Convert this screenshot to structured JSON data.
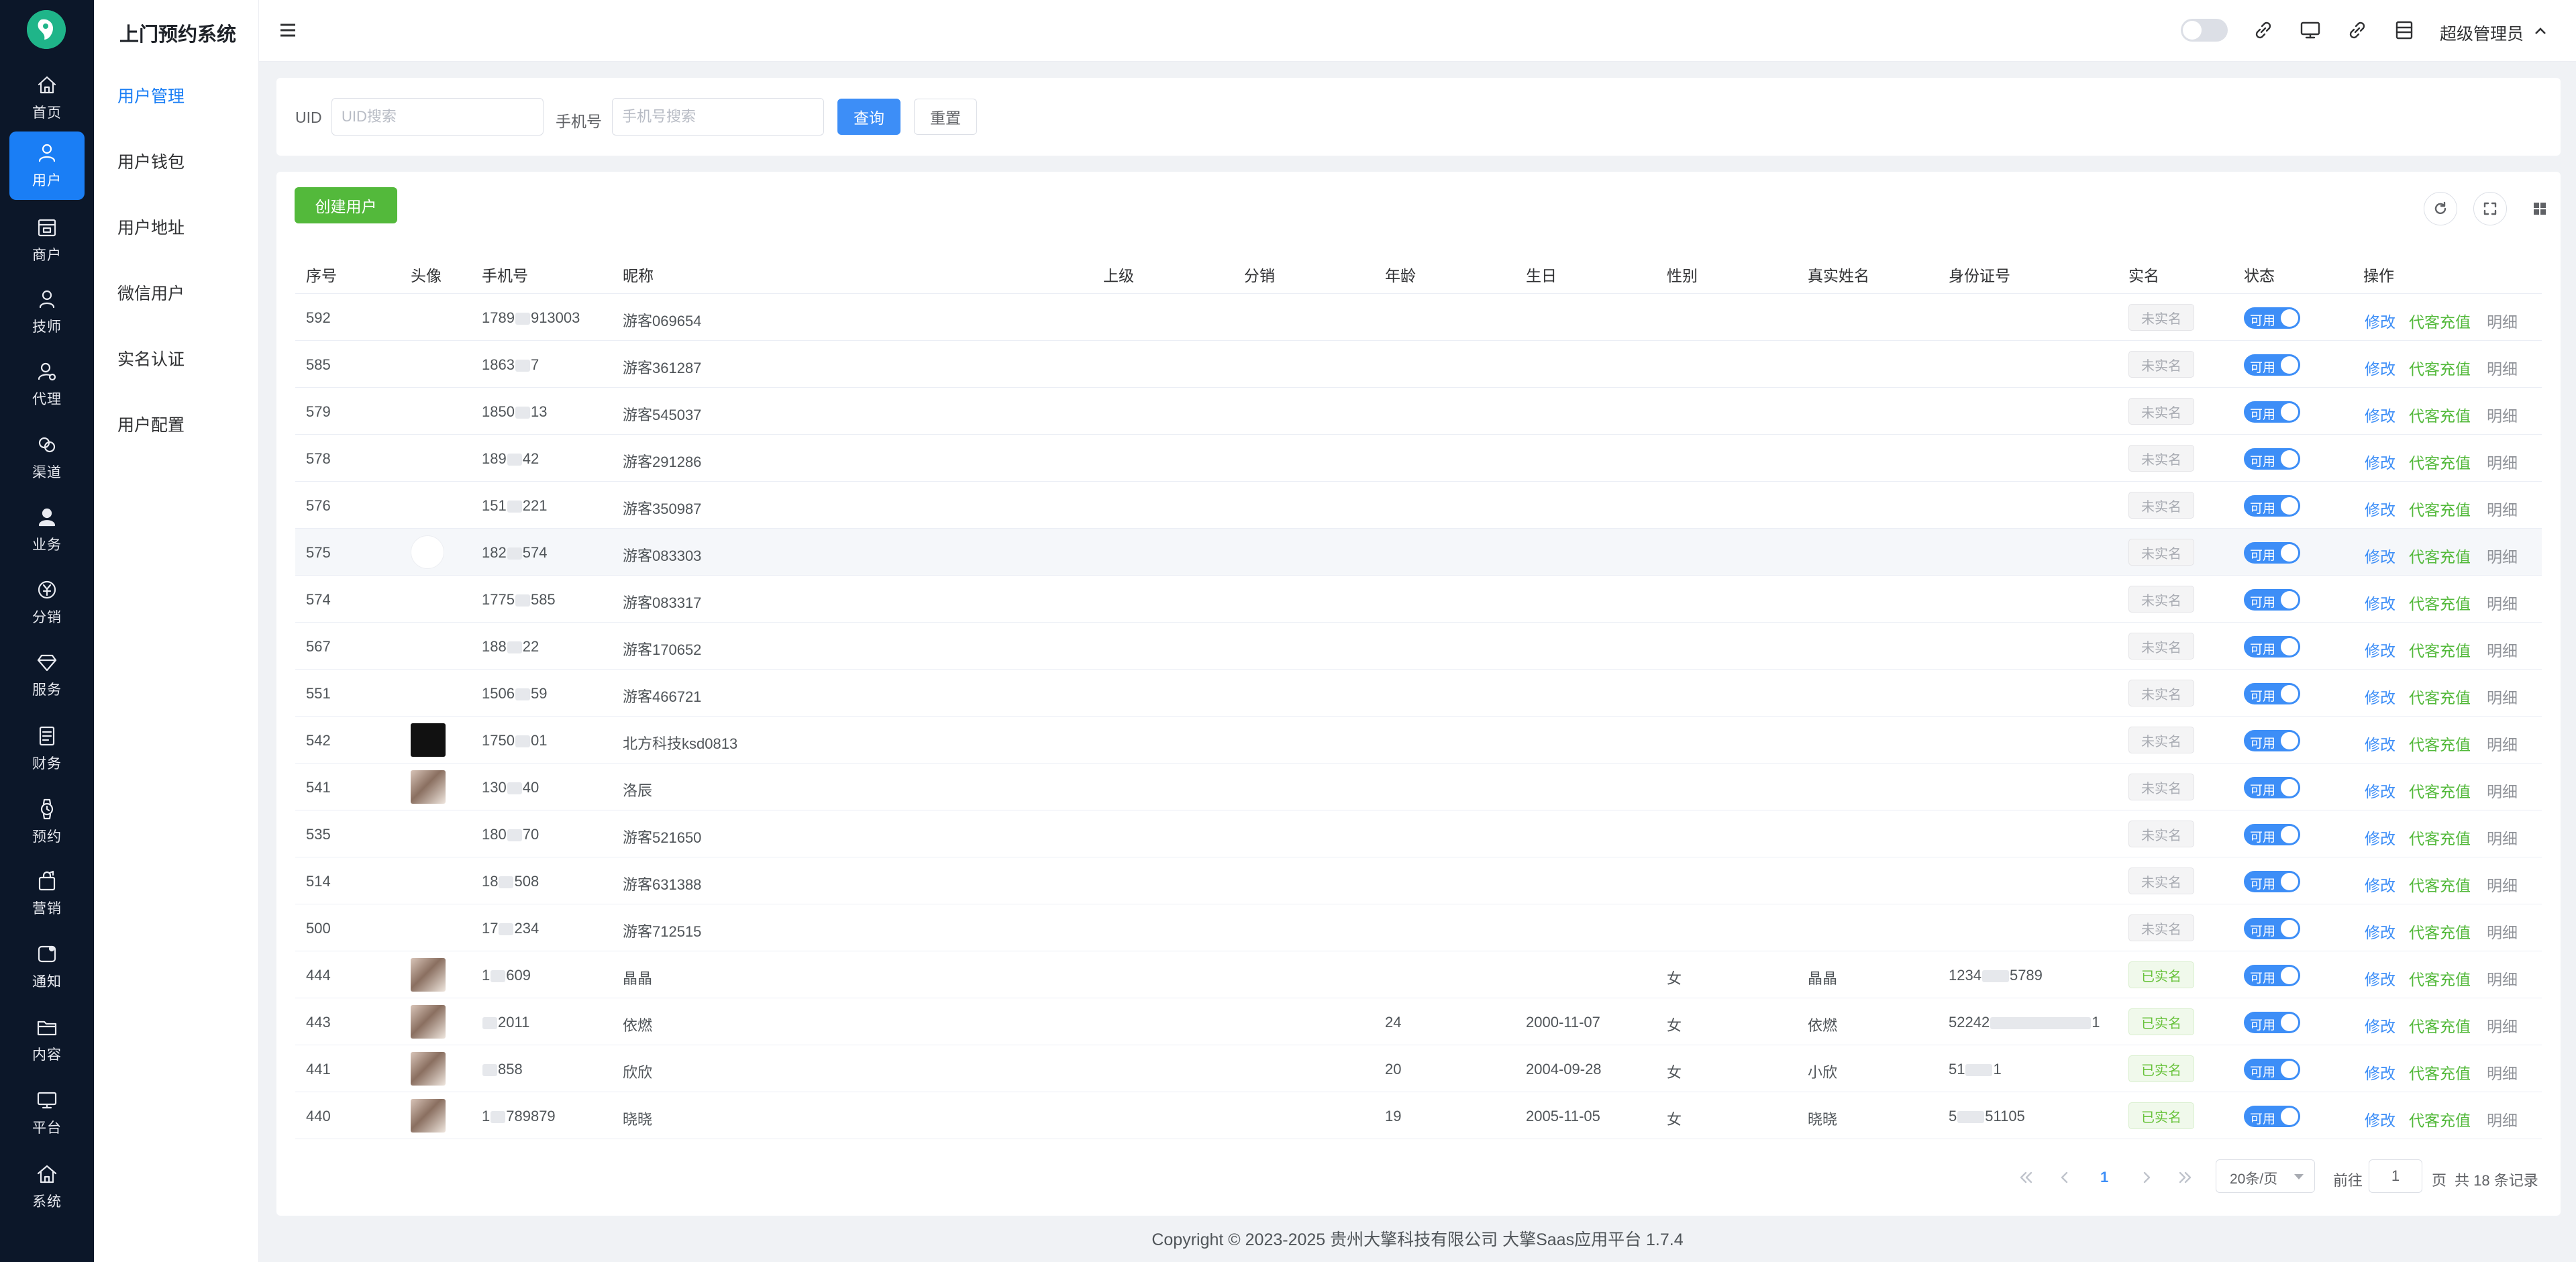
{
  "app": {
    "title": "上门预约系统"
  },
  "rail": [
    {
      "key": "home",
      "label": "首页",
      "icon": "home-icon"
    },
    {
      "key": "user",
      "label": "用户",
      "icon": "user-icon",
      "active": true
    },
    {
      "key": "merchant",
      "label": "商户",
      "icon": "shop-icon"
    },
    {
      "key": "tech",
      "label": "技师",
      "icon": "person-icon"
    },
    {
      "key": "agent",
      "label": "代理",
      "icon": "agent-icon"
    },
    {
      "key": "channel",
      "label": "渠道",
      "icon": "link-icon"
    },
    {
      "key": "business",
      "label": "业务",
      "icon": "person-solid-icon"
    },
    {
      "key": "distribution",
      "label": "分销",
      "icon": "yen-icon"
    },
    {
      "key": "service",
      "label": "服务",
      "icon": "diamond-icon"
    },
    {
      "key": "finance",
      "label": "财务",
      "icon": "document-icon"
    },
    {
      "key": "booking",
      "label": "预约",
      "icon": "watch-icon"
    },
    {
      "key": "marketing",
      "label": "营销",
      "icon": "bag-icon"
    },
    {
      "key": "notice",
      "label": "通知",
      "icon": "message-icon"
    },
    {
      "key": "content",
      "label": "内容",
      "icon": "folder-icon"
    },
    {
      "key": "platform",
      "label": "平台",
      "icon": "monitor-icon"
    },
    {
      "key": "system",
      "label": "系统",
      "icon": "house-icon"
    }
  ],
  "submenu": [
    {
      "label": "用户管理",
      "active": true
    },
    {
      "label": "用户钱包"
    },
    {
      "label": "用户地址"
    },
    {
      "label": "微信用户"
    },
    {
      "label": "实名认证"
    },
    {
      "label": "用户配置"
    }
  ],
  "topbar": {
    "user_name": "超级管理员"
  },
  "search": {
    "uid_label": "UID",
    "uid_placeholder": "UID搜索",
    "phone_label": "手机号",
    "phone_placeholder": "手机号搜索",
    "query_button": "查询",
    "reset_button": "重置"
  },
  "table": {
    "create_button": "创建用户",
    "columns": [
      "序号",
      "头像",
      "手机号",
      "昵称",
      "上级",
      "分销",
      "年龄",
      "生日",
      "性别",
      "真实姓名",
      "身份证号",
      "实名",
      "状态",
      "操作"
    ],
    "switch_label": "可用",
    "op_edit": "修改",
    "op_charge": "代客充值",
    "op_detail": "明细",
    "rows": [
      {
        "id": "592",
        "avatar": "",
        "phone_a": "1789",
        "phone_b": "913003",
        "nickname": "游客069654",
        "age": "",
        "birthday": "",
        "gender": "",
        "real_name": "",
        "idcard_a": "",
        "idcard_b": "",
        "verified": "未实名"
      },
      {
        "id": "585",
        "avatar": "",
        "phone_a": "1863",
        "phone_b": "7",
        "nickname": "游客361287",
        "age": "",
        "birthday": "",
        "gender": "",
        "real_name": "",
        "idcard_a": "",
        "idcard_b": "",
        "verified": "未实名"
      },
      {
        "id": "579",
        "avatar": "",
        "phone_a": "1850",
        "phone_b": "13",
        "nickname": "游客545037",
        "age": "",
        "birthday": "",
        "gender": "",
        "real_name": "",
        "idcard_a": "",
        "idcard_b": "",
        "verified": "未实名"
      },
      {
        "id": "578",
        "avatar": "",
        "phone_a": "189",
        "phone_b": "42",
        "nickname": "游客291286",
        "age": "",
        "birthday": "",
        "gender": "",
        "real_name": "",
        "idcard_a": "",
        "idcard_b": "",
        "verified": "未实名"
      },
      {
        "id": "576",
        "avatar": "",
        "phone_a": "151",
        "phone_b": "221",
        "nickname": "游客350987",
        "age": "",
        "birthday": "",
        "gender": "",
        "real_name": "",
        "idcard_a": "",
        "idcard_b": "",
        "verified": "未实名"
      },
      {
        "id": "575",
        "avatar": "blank",
        "phone_a": "182",
        "phone_b": "574",
        "nickname": "游客083303",
        "age": "",
        "birthday": "",
        "gender": "",
        "real_name": "",
        "idcard_a": "",
        "idcard_b": "",
        "verified": "未实名",
        "hover": true
      },
      {
        "id": "574",
        "avatar": "",
        "phone_a": "1775",
        "phone_b": "585",
        "nickname": "游客083317",
        "age": "",
        "birthday": "",
        "gender": "",
        "real_name": "",
        "idcard_a": "",
        "idcard_b": "",
        "verified": "未实名"
      },
      {
        "id": "567",
        "avatar": "",
        "phone_a": "188",
        "phone_b": "22",
        "nickname": "游客170652",
        "age": "",
        "birthday": "",
        "gender": "",
        "real_name": "",
        "idcard_a": "",
        "idcard_b": "",
        "verified": "未实名"
      },
      {
        "id": "551",
        "avatar": "",
        "phone_a": "1506",
        "phone_b": "59",
        "nickname": "游客466721",
        "age": "",
        "birthday": "",
        "gender": "",
        "real_name": "",
        "idcard_a": "",
        "idcard_b": "",
        "verified": "未实名"
      },
      {
        "id": "542",
        "avatar": "dark",
        "phone_a": "1750",
        "phone_b": "01",
        "nickname": "北方科技ksd0813",
        "age": "",
        "birthday": "",
        "gender": "",
        "real_name": "",
        "idcard_a": "",
        "idcard_b": "",
        "verified": "未实名"
      },
      {
        "id": "541",
        "avatar": "photo",
        "phone_a": "130",
        "phone_b": "40",
        "nickname": "洛辰",
        "age": "",
        "birthday": "",
        "gender": "",
        "real_name": "",
        "idcard_a": "",
        "idcard_b": "",
        "verified": "未实名"
      },
      {
        "id": "535",
        "avatar": "",
        "phone_a": "180",
        "phone_b": "70",
        "nickname": "游客521650",
        "age": "",
        "birthday": "",
        "gender": "",
        "real_name": "",
        "idcard_a": "",
        "idcard_b": "",
        "verified": "未实名"
      },
      {
        "id": "514",
        "avatar": "",
        "phone_a": "18",
        "phone_b": "508",
        "nickname": "游客631388",
        "age": "",
        "birthday": "",
        "gender": "",
        "real_name": "",
        "idcard_a": "",
        "idcard_b": "",
        "verified": "未实名"
      },
      {
        "id": "500",
        "avatar": "",
        "phone_a": "17",
        "phone_b": "234",
        "nickname": "游客712515",
        "age": "",
        "birthday": "",
        "gender": "",
        "real_name": "",
        "idcard_a": "",
        "idcard_b": "",
        "verified": "未实名"
      },
      {
        "id": "444",
        "avatar": "photo",
        "phone_a": "1",
        "phone_b": "609",
        "nickname": "晶晶",
        "age": "",
        "birthday": "",
        "gender": "女",
        "real_name": "晶晶",
        "idcard_a": "1234",
        "idcard_b": "5789",
        "verified": "已实名"
      },
      {
        "id": "443",
        "avatar": "photo",
        "phone_a": "",
        "phone_b": "2011",
        "nickname": "依燃",
        "age": "24",
        "birthday": "2000-11-07",
        "gender": "女",
        "real_name": "依燃",
        "idcard_a": "52242",
        "idcard_b": "1",
        "verified": "已实名"
      },
      {
        "id": "441",
        "avatar": "photo",
        "phone_a": "",
        "phone_b": "858",
        "nickname": "欣欣",
        "age": "20",
        "birthday": "2004-09-28",
        "gender": "女",
        "real_name": "小欣",
        "idcard_a": "51",
        "idcard_b": "1",
        "verified": "已实名"
      },
      {
        "id": "440",
        "avatar": "photo",
        "phone_a": "1",
        "phone_b": "789879",
        "nickname": "晓晓",
        "age": "19",
        "birthday": "2005-11-05",
        "gender": "女",
        "real_name": "晓晓",
        "idcard_a": "5",
        "idcard_b": "51105",
        "verified": "已实名"
      }
    ]
  },
  "pagination": {
    "current_page": "1",
    "page_size": "20条/页",
    "goto_label": "前往",
    "goto_value": "1",
    "page_unit": "页",
    "total": "共 18 条记录"
  },
  "footer": {
    "copyright": "Copyright © 2023-2025 贵州大擎科技有限公司  大擎Saas应用平台 1.7.4"
  },
  "colors": {
    "primary": "#3d8ef7",
    "success": "#53b93b",
    "rail_bg": "#0c1729"
  }
}
